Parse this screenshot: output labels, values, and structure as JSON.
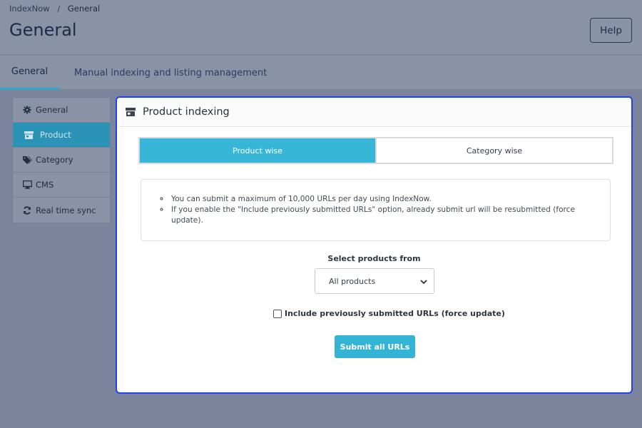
{
  "breadcrumb": {
    "root": "IndexNow",
    "separator": "/",
    "current": "General"
  },
  "header": {
    "title": "General",
    "help_label": "Help"
  },
  "tabs": [
    {
      "label": "General",
      "active": true
    },
    {
      "label": "Manual indexing and listing management",
      "active": false
    }
  ],
  "side_menu": {
    "items": [
      {
        "label": "General",
        "icon": "gear-icon",
        "active": false
      },
      {
        "label": "Product",
        "icon": "store-icon",
        "active": true
      },
      {
        "label": "Category",
        "icon": "tags-icon",
        "active": false
      },
      {
        "label": "CMS",
        "icon": "desktop-icon",
        "active": false
      },
      {
        "label": "Real time sync",
        "icon": "sync-icon",
        "active": false
      }
    ]
  },
  "panel": {
    "title": "Product indexing",
    "icon": "store-icon",
    "segments": [
      {
        "label": "Product wise",
        "active": true
      },
      {
        "label": "Category wise",
        "active": false
      }
    ],
    "info": [
      "You can submit a maximum of 10,000 URLs per day using IndexNow.",
      "If you enable the \"Include previously submitted URLs\" option, already submit url will be resubmitted (force update)."
    ],
    "select_label": "Select products from",
    "select_value": "All products",
    "checkbox_label": "Include previously submitted URLs (force update)",
    "checkbox_checked": false,
    "submit_label": "Submit all URLs"
  },
  "colors": {
    "accent": "#37b6d8",
    "focus_border": "#2241ef",
    "overlay_bg": "#7b849c"
  }
}
